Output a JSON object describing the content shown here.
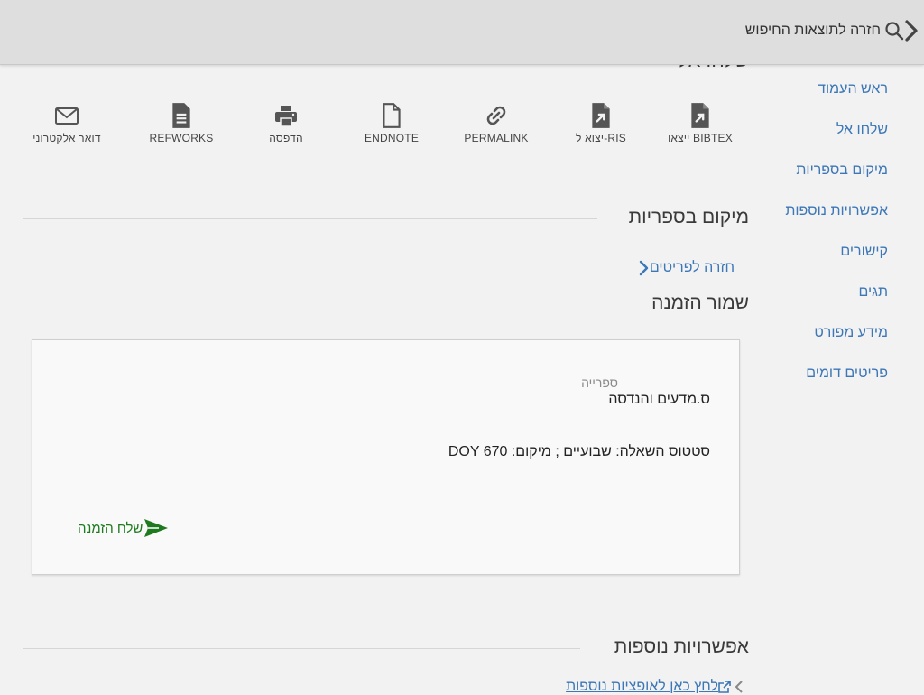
{
  "topbar": {
    "back_to_results": "חזרה לתוצאות החיפוש",
    "icons": [
      "chevron-right-icon",
      "search-icon"
    ]
  },
  "send_to": {
    "title": "שלחו אל",
    "actions": [
      {
        "label": "ייצאו BIBTEX",
        "icon": "export-file-icon"
      },
      {
        "label": "יצוא ל-RIS",
        "icon": "export-file-icon"
      },
      {
        "label": "PERMALINK",
        "icon": "link-icon"
      },
      {
        "label": "ENDNOTE",
        "icon": "document-icon"
      },
      {
        "label": "הדפסה",
        "icon": "printer-icon"
      },
      {
        "label": "REFWORKS",
        "icon": "text-document-icon"
      },
      {
        "label": "דואר אלקטרוני",
        "icon": "envelope-icon"
      }
    ]
  },
  "side_nav": {
    "items": [
      "ראש העמוד",
      "שלחו אל",
      "מיקום בספריות",
      "אפשרויות נוספות",
      "קישורים",
      "תגים",
      "מידע מפורט",
      "פריטים דומים"
    ]
  },
  "location": {
    "title": "מיקום בספריות",
    "back_to_items": "חזרה לפריטים"
  },
  "hold": {
    "title": "שמור הזמנה",
    "library_label": "ספרייה",
    "library_value": "ס.מדעים והנדסה",
    "status": "סטטוס השאלה: שבועיים ; מיקום: DOY 670",
    "send_request": "שלח הזמנה"
  },
  "more_options": {
    "title": "אפשרויות נוספות",
    "link": "לחץ כאן לאופציות נוספות"
  },
  "colors": {
    "link": "#3c77b7",
    "send": "#1e7a1e",
    "topbar": "#dedede",
    "background": "#f2f2f2"
  }
}
